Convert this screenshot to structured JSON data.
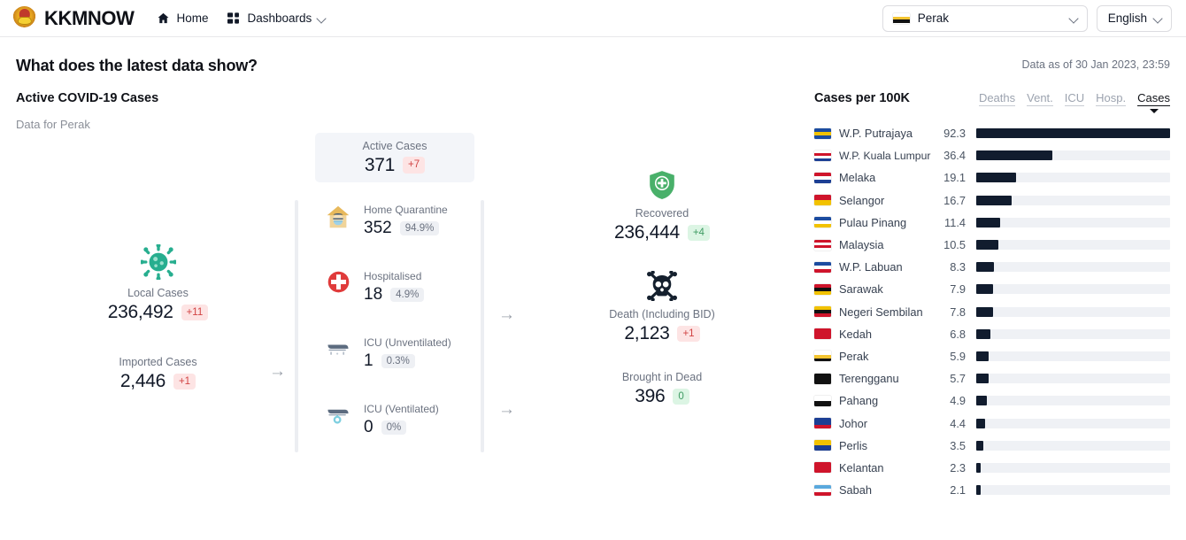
{
  "navbar": {
    "brand": "KKMNOW",
    "crest_icon": "malaysia-crest-icon",
    "links": [
      {
        "label": "Home",
        "icon": "home-icon"
      },
      {
        "label": "Dashboards",
        "icon": "grid-icon",
        "caret": "chevron-down-icon"
      }
    ],
    "state_selected": "Perak",
    "state_flag": "perak-flag",
    "language_selected": "English"
  },
  "page": {
    "title": "What does the latest data show?",
    "data_asof": "Data as of 30 Jan 2023, 23:59"
  },
  "active_section": {
    "title": "Active COVID-19 Cases",
    "subtitle": "Data for Perak",
    "cases": {
      "virus_icon": "virus-icon",
      "local_label": "Local Cases",
      "local_value": "236,492",
      "local_delta": "+11",
      "imported_label": "Imported Cases",
      "imported_value": "2,446",
      "imported_delta": "+1"
    },
    "active_box": {
      "label": "Active Cases",
      "value": "371",
      "delta": "+7"
    },
    "breakdown": [
      {
        "icon": "home-quarantine-icon",
        "label": "Home Quarantine",
        "value": "352",
        "pct": "94.9%"
      },
      {
        "icon": "hospital-cross-icon",
        "label": "Hospitalised",
        "value": "18",
        "pct": "4.9%"
      },
      {
        "icon": "icu-bed-icon",
        "label": "ICU (Unventilated)",
        "value": "1",
        "pct": "0.3%"
      },
      {
        "icon": "icu-ventilator-icon",
        "label": "ICU (Ventilated)",
        "value": "0",
        "pct": "0%"
      }
    ],
    "outcomes": {
      "recovered": {
        "icon": "shield-plus-icon",
        "label": "Recovered",
        "value": "236,444",
        "delta": "+4"
      },
      "death": {
        "icon": "skull-icon",
        "label": "Death (Including BID)",
        "value": "2,123",
        "delta": "+1"
      },
      "bid": {
        "label": "Brought in Dead",
        "value": "396",
        "delta": "0"
      }
    },
    "arrows": {
      "glyph": "→",
      "name": "arrow-right-icon"
    }
  },
  "ranking": {
    "title": "Cases per 100K",
    "tabs": [
      {
        "label": "Deaths",
        "active": false
      },
      {
        "label": "Vent.",
        "active": false
      },
      {
        "label": "ICU",
        "active": false
      },
      {
        "label": "Hosp.",
        "active": false
      },
      {
        "label": "Cases",
        "active": true
      }
    ],
    "rows": [
      {
        "name": "W.P. Putrajaya",
        "value": "92.3",
        "flag": "putrajaya"
      },
      {
        "name": "W.P. Kuala Lumpur",
        "value": "36.4",
        "flag": "kl"
      },
      {
        "name": "Melaka",
        "value": "19.1",
        "flag": "melaka"
      },
      {
        "name": "Selangor",
        "value": "16.7",
        "flag": "selangor"
      },
      {
        "name": "Pulau Pinang",
        "value": "11.4",
        "flag": "penang"
      },
      {
        "name": "Malaysia",
        "value": "10.5",
        "flag": "malaysia"
      },
      {
        "name": "W.P. Labuan",
        "value": "8.3",
        "flag": "labuan"
      },
      {
        "name": "Sarawak",
        "value": "7.9",
        "flag": "sarawak"
      },
      {
        "name": "Negeri Sembilan",
        "value": "7.8",
        "flag": "negeri"
      },
      {
        "name": "Kedah",
        "value": "6.8",
        "flag": "kedah"
      },
      {
        "name": "Perak",
        "value": "5.9",
        "flag": "perak"
      },
      {
        "name": "Terengganu",
        "value": "5.7",
        "flag": "terengganu"
      },
      {
        "name": "Pahang",
        "value": "4.9",
        "flag": "pahang"
      },
      {
        "name": "Johor",
        "value": "4.4",
        "flag": "johor"
      },
      {
        "name": "Perlis",
        "value": "3.5",
        "flag": "perlis"
      },
      {
        "name": "Kelantan",
        "value": "2.3",
        "flag": "kelantan"
      },
      {
        "name": "Sabah",
        "value": "2.1",
        "flag": "sabah"
      }
    ],
    "bar_max": 92.3,
    "bar_color": "#111c2e",
    "track_color": "#eff1f5"
  },
  "chart_data": {
    "type": "bar",
    "title": "Cases per 100K",
    "orientation": "horizontal",
    "categories": [
      "W.P. Putrajaya",
      "W.P. Kuala Lumpur",
      "Melaka",
      "Selangor",
      "Pulau Pinang",
      "Malaysia",
      "W.P. Labuan",
      "Sarawak",
      "Negeri Sembilan",
      "Kedah",
      "Perak",
      "Terengganu",
      "Pahang",
      "Johor",
      "Perlis",
      "Kelantan",
      "Sabah"
    ],
    "values": [
      92.3,
      36.4,
      19.1,
      16.7,
      11.4,
      10.5,
      8.3,
      7.9,
      7.8,
      6.8,
      5.9,
      5.7,
      4.9,
      4.4,
      3.5,
      2.3,
      2.1
    ],
    "xlabel": "",
    "ylabel": "",
    "xlim": [
      0,
      92.3
    ],
    "grid": false,
    "legend": "none"
  }
}
